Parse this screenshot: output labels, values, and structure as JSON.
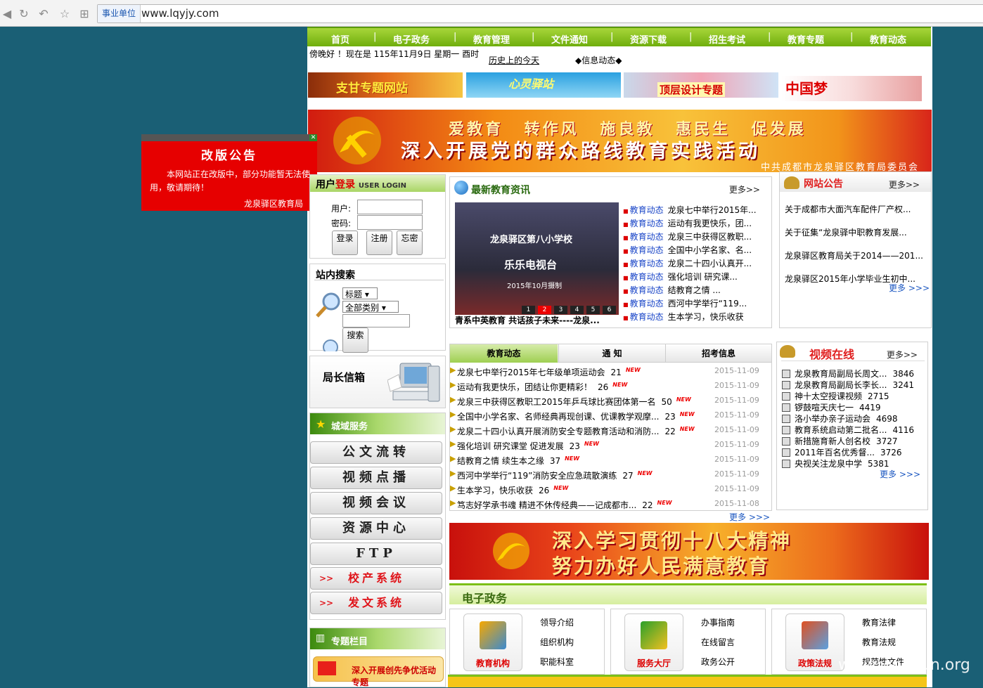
{
  "browser": {
    "tag": "事业单位",
    "url": "www.lqyjy.com"
  },
  "nav": [
    "首页",
    "电子政务",
    "教育管理",
    "文件通知",
    "资源下载",
    "招生考试",
    "教育专题",
    "教育动态"
  ],
  "greeting": "傍晚好 ！现在是 115年11月9日 星期一 酉时",
  "history": "历史上的今天",
  "info": "◆信息动态◆",
  "banners": [
    "支甘专题网站",
    "心灵驿站",
    "顶层设计专题",
    "中国梦"
  ],
  "bigbanner": {
    "line1": "爱教育 转作风 施良教 惠民生 促发展",
    "line2": "深入开展党的群众路线教育实践活动",
    "sub": "中共成都市龙泉驿区教育局委员会"
  },
  "popup": {
    "title": "改版公告",
    "body": "本网站正在改版中，部分功能暂无法使用，敬请期待！",
    "sign": "龙泉驿区教育局"
  },
  "login": {
    "title": "用户",
    "title_red": "登录",
    "title_en": "USER LOGIN",
    "user_label": "用户:",
    "pwd_label": "密码:",
    "btns": [
      "登录",
      "注册",
      "忘密"
    ]
  },
  "search": {
    "title": "站内搜索",
    "opt1": "标题",
    "opt2": "全部类别",
    "btn": "搜索"
  },
  "mailbox": "局长信箱",
  "service": {
    "title": "城域服务",
    "items": [
      "公文流转",
      "视频点播",
      "视频会议",
      "资源中心",
      "FTP"
    ],
    "red_items": [
      "校产系统",
      "发文系统"
    ],
    "arrow": ">>"
  },
  "topic": {
    "title": "专题栏目",
    "item": "深入开展创先争优活动专题"
  },
  "news": {
    "title": "最新教育资讯",
    "more": "更多>>",
    "caption": "青系中英教育 共话孩子未来----龙泉...",
    "img_text": [
      "龙泉驿区第八小学校",
      "乐乐电视台",
      "2015年10月摄制"
    ],
    "pages": [
      "1",
      "2",
      "3",
      "4",
      "5",
      "6"
    ],
    "items": [
      {
        "cat": "教育动态",
        "text": "龙泉七中举行2015年..."
      },
      {
        "cat": "教育动态",
        "text": "运动有我更快乐，团..."
      },
      {
        "cat": "教育动态",
        "text": "龙泉三中获得区教职..."
      },
      {
        "cat": "教育动态",
        "text": "全国中小学名家、名..."
      },
      {
        "cat": "教育动态",
        "text": "龙泉二十四小认真开..."
      },
      {
        "cat": "教育动态",
        "text": "强化培训 研究课..."
      },
      {
        "cat": "教育动态",
        "text": "结教育之情 ..."
      },
      {
        "cat": "教育动态",
        "text": "西河中学举行“119..."
      },
      {
        "cat": "教育动态",
        "text": "生本学习，快乐收获"
      }
    ]
  },
  "announce": {
    "title": "网站公告",
    "more": "更多>>",
    "more2": "更多 >>>",
    "items": [
      "关于成都市大面汽车配件厂产权...",
      "关于征集“龙泉驿中职教育发展...",
      "龙泉驿区教育局关于2014——201...",
      "龙泉驿区2015年小学毕业生初中..."
    ]
  },
  "tabs": {
    "items": [
      "教育动态",
      "通 知",
      "招考信息"
    ],
    "more": "更多 >>>",
    "rows": [
      {
        "t": "龙泉七中举行2015年七年级单项运动会",
        "n": "21",
        "d": "2015-11-09"
      },
      {
        "t": "运动有我更快乐，团结让你更精彩！",
        "n": "26",
        "d": "2015-11-09"
      },
      {
        "t": "龙泉三中获得区教职工2015年乒乓球比赛团体第一名",
        "n": "50",
        "d": "2015-11-09"
      },
      {
        "t": "全国中小学名家、名师经典再现创课、优课教学观摩...",
        "n": "23",
        "d": "2015-11-09"
      },
      {
        "t": "龙泉二十四小认真开展消防安全专题教育活动和消防...",
        "n": "22",
        "d": "2015-11-09"
      },
      {
        "t": "强化培训 研究课堂 促进发展",
        "n": "23",
        "d": "2015-11-09"
      },
      {
        "t": "结教育之情 续生本之缘",
        "n": "37",
        "d": "2015-11-09"
      },
      {
        "t": "西河中学举行“119”消防安全应急疏散演练",
        "n": "27",
        "d": "2015-11-09"
      },
      {
        "t": "生本学习，快乐收获",
        "n": "26",
        "d": "2015-11-09"
      },
      {
        "t": "笃志好学承书魂 精进不休传经典——记成都市...",
        "n": "22",
        "d": "2015-11-08"
      }
    ],
    "new": "NEW"
  },
  "video": {
    "title": "视频在线",
    "more": "更多>>",
    "more2": "更多 >>>",
    "items": [
      {
        "t": "龙泉教育局副局长周文...",
        "n": "3846"
      },
      {
        "t": "龙泉教育局副局长李长...",
        "n": "3241"
      },
      {
        "t": "神十太空授课视频",
        "n": "2715"
      },
      {
        "t": "锣鼓喧天庆七一",
        "n": "4419"
      },
      {
        "t": "洛小举办亲子运动会",
        "n": "4698"
      },
      {
        "t": "教育系统启动第二批名...",
        "n": "4116"
      },
      {
        "t": "新措施育新人创名校",
        "n": "3727"
      },
      {
        "t": "2011年百名优秀督...",
        "n": "3726"
      },
      {
        "t": "央视关注龙泉中学",
        "n": "5381"
      }
    ]
  },
  "banner2": {
    "l1": "深入学习贯彻十八大精神",
    "l2": "努力办好人民满意教育"
  },
  "egov": {
    "title": "电子政务",
    "groups": [
      {
        "icon": "教育机构",
        "links": [
          "领导介绍",
          "组织机构",
          "职能科室"
        ]
      },
      {
        "icon": "服务大厅",
        "links": [
          "办事指南",
          "在线留言",
          "政务公开"
        ]
      },
      {
        "icon": "政策法规",
        "links": [
          "教育法律",
          "教育法规",
          "规范性文件"
        ]
      }
    ]
  },
  "watermark": "www.wooyun.org",
  "colors": {
    "nav_green": "#7fc013",
    "popup_red": "#e60000",
    "bg": "#1a5f75"
  }
}
